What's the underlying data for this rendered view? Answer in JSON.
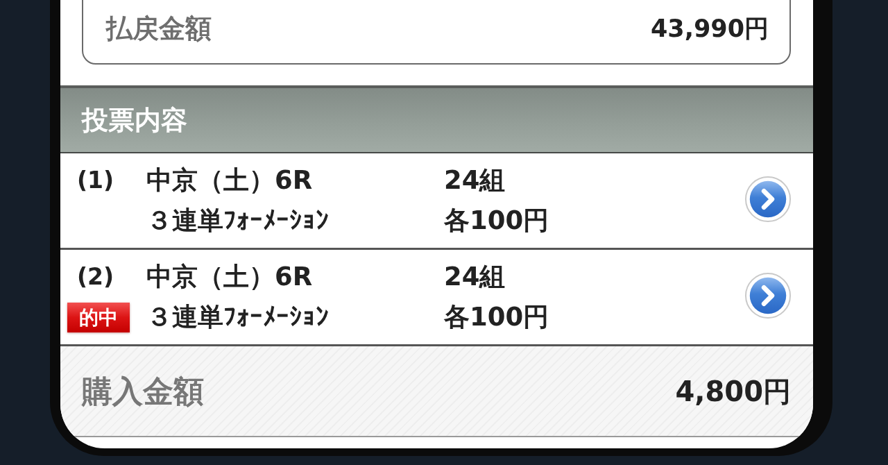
{
  "payout": {
    "label": "払戻金額",
    "amount": "43,990円"
  },
  "section": {
    "title": "投票内容"
  },
  "bets": [
    {
      "number": "(1)",
      "race": "中京（土）6R",
      "bet_type": "３連単ﾌｫｰﾒｰｼｮﾝ",
      "combinations": "24組",
      "unit_price": "各100円",
      "hit": false
    },
    {
      "number": "(2)",
      "race": "中京（土）6R",
      "bet_type": "３連単ﾌｫｰﾒｰｼｮﾝ",
      "combinations": "24組",
      "unit_price": "各100円",
      "hit": true,
      "hit_label": "的中"
    }
  ],
  "purchase": {
    "label": "購入金額",
    "amount": "4,800円"
  }
}
